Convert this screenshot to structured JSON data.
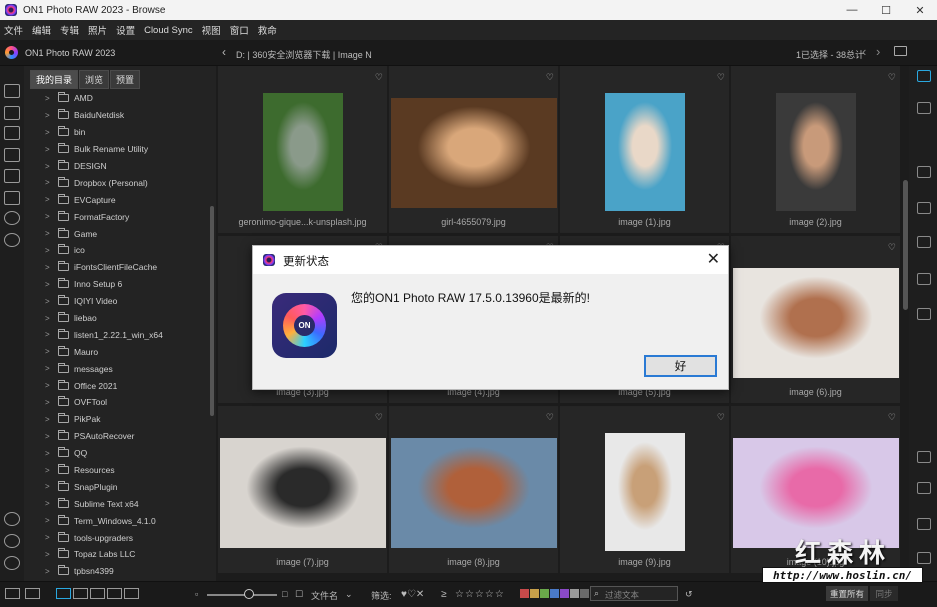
{
  "window": {
    "title": "ON1 Photo RAW 2023 - Browse",
    "controls": [
      "—",
      "☐",
      "✕"
    ]
  },
  "menu": [
    "文件",
    "编辑",
    "专辑",
    "照片",
    "设置",
    "Cloud Sync",
    "视图",
    "窗口",
    "救命"
  ],
  "header": {
    "app_name": "ON1 Photo RAW 2023",
    "path": "D: | 360安全浏览器下载 | Image N",
    "selection": "1已选择 - 38总计"
  },
  "left_panel": {
    "tabs": [
      "我的目录",
      "浏览",
      "预置"
    ],
    "folders": [
      "AMD",
      "BaiduNetdisk",
      "bin",
      "Bulk Rename Utility",
      "DESIGN",
      "Dropbox (Personal)",
      "EVCapture",
      "FormatFactory",
      "Game",
      "ico",
      "iFontsClientFileCache",
      "Inno Setup 6",
      "IQIYI Video",
      "liebao",
      "listen1_2.22.1_win_x64",
      "Mauro",
      "messages",
      "Office 2021",
      "OVFTool",
      "PikPak",
      "PSAutoRecover",
      "QQ",
      "Resources",
      "SnapPlugin",
      "Sublime Text x64",
      "Term_Windows_4.1.0",
      "tools-upgraders",
      "Topaz Labs LLC",
      "tpbsn4399"
    ]
  },
  "grid": {
    "items": [
      {
        "name": "geronimo-gique...k-unsplash.jpg",
        "bg": "#3d6b2e",
        "fg": "#8a9a8a"
      },
      {
        "name": "girl-4655079.jpg",
        "bg": "#5a3a22",
        "fg": "#d9a77a"
      },
      {
        "name": "image (1).jpg",
        "bg": "#4aa3c8",
        "fg": "#e9d8c8"
      },
      {
        "name": "image (2).jpg",
        "bg": "#3a3a3a",
        "fg": "#c89a7a"
      },
      {
        "name": "image (3).jpg",
        "bg": "#4a4a4a",
        "fg": "#888888"
      },
      {
        "name": "image (4).jpg",
        "bg": "#4a4a4a",
        "fg": "#888888"
      },
      {
        "name": "image (5).jpg",
        "bg": "#4a4a4a",
        "fg": "#888888"
      },
      {
        "name": "image (6).jpg",
        "bg": "#e8e4df",
        "fg": "#b0704e"
      },
      {
        "name": "image (7).jpg",
        "bg": "#d8d4cf",
        "fg": "#2a2a2a"
      },
      {
        "name": "image (8).jpg",
        "bg": "#6a8aa8",
        "fg": "#b0603a"
      },
      {
        "name": "image (9).jpg",
        "bg": "#e8e8e8",
        "fg": "#c8a078"
      },
      {
        "name": "image (10).jpg",
        "bg": "#d8c8e8",
        "fg": "#e86aa8"
      }
    ]
  },
  "bottom": {
    "sort_label": "文件名",
    "filter_label": "筛选:",
    "search_placeholder": "过滤文本",
    "reset_label": "重置所有",
    "sync_label": "同步",
    "swatches": [
      "#c84a4a",
      "#c8a04a",
      "#6aa84a",
      "#4a7ac8",
      "#8a4ac8",
      "#9a9a9a",
      "#6a6a6a"
    ]
  },
  "dialog": {
    "title": "更新状态",
    "message": "您的ON1 Photo RAW 17.5.0.13960是最新的!",
    "ok_label": "好",
    "logo_text": "ON"
  },
  "watermark": {
    "big_text": "红森林",
    "url": "http://www.hoslin.cn/"
  }
}
